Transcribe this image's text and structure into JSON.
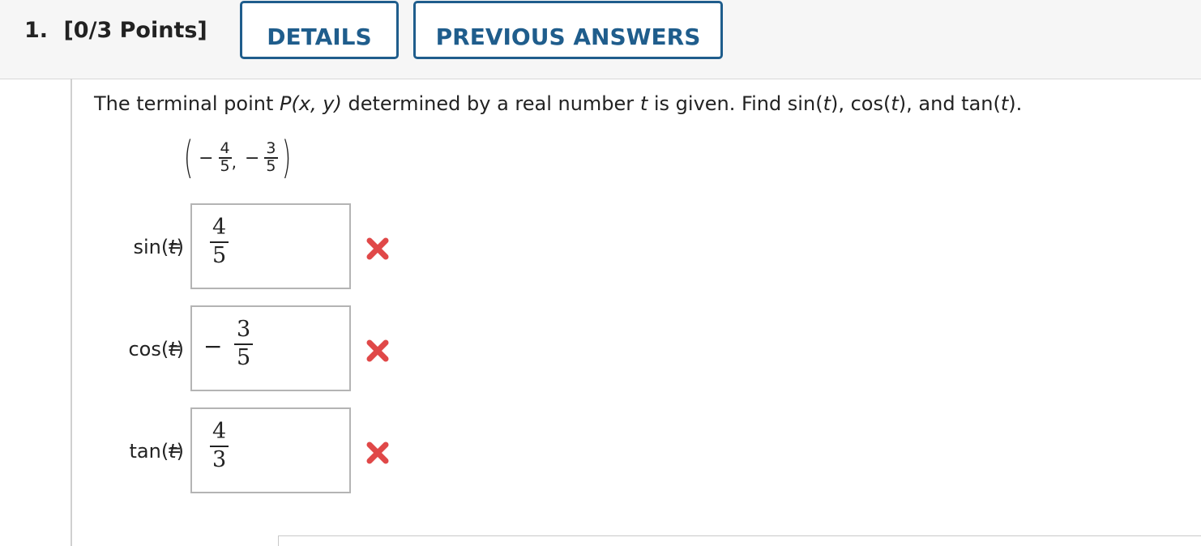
{
  "question": {
    "number_label": "1.",
    "points_label": "[0/3 Points]",
    "details_button": "DETAILS",
    "previous_answers_button": "PREVIOUS ANSWERS"
  },
  "prompt": {
    "part1": "The terminal point ",
    "point_expr": "P(x, y)",
    "part2": " determined by a real number ",
    "var_t": "t",
    "part3": " is given. Find sin(",
    "part4": "), cos(",
    "part5": "), and tan(",
    "part6": ")."
  },
  "point": {
    "x_sign": "−",
    "x_num": "4",
    "x_den": "5",
    "y_sign": "−",
    "y_num": "3",
    "y_den": "5"
  },
  "answers": [
    {
      "fn": "sin",
      "sign": "",
      "num": "4",
      "den": "5",
      "status": "incorrect"
    },
    {
      "fn": "cos",
      "sign": "−",
      "num": "3",
      "den": "5",
      "status": "incorrect"
    },
    {
      "fn": "tan",
      "sign": "",
      "num": "4",
      "den": "3",
      "status": "incorrect"
    }
  ],
  "colors": {
    "accent": "#1f5d8c",
    "incorrect": "#e04848"
  },
  "icons": {
    "incorrect": "x-mark-icon"
  }
}
